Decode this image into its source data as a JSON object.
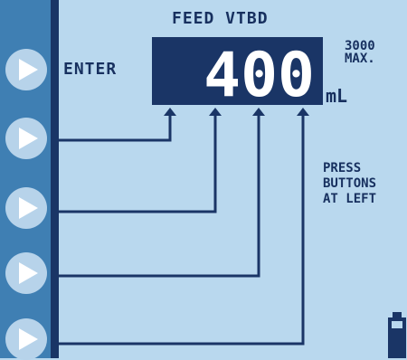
{
  "screen": {
    "title": "FEED VTBD",
    "enter_label": "ENTER",
    "value": "400",
    "unit": "mL",
    "max_line1": "3000",
    "max_line2": "MAX.",
    "instructions": [
      "PRESS",
      "BUTTONS",
      "AT LEFT"
    ]
  },
  "buttons": [
    {
      "icon": "play-arrow-icon",
      "action": "enter"
    },
    {
      "icon": "play-arrow-icon",
      "action": "digit-1"
    },
    {
      "icon": "play-arrow-icon",
      "action": "digit-2"
    },
    {
      "icon": "play-arrow-icon",
      "action": "digit-3"
    },
    {
      "icon": "play-arrow-icon",
      "action": "digit-4"
    }
  ],
  "colors": {
    "background": "#b9d8ee",
    "rail": "#3f7fb3",
    "dark": "#1a3566",
    "button": "#b7d3ea"
  },
  "icons": {
    "battery": "battery-icon"
  }
}
